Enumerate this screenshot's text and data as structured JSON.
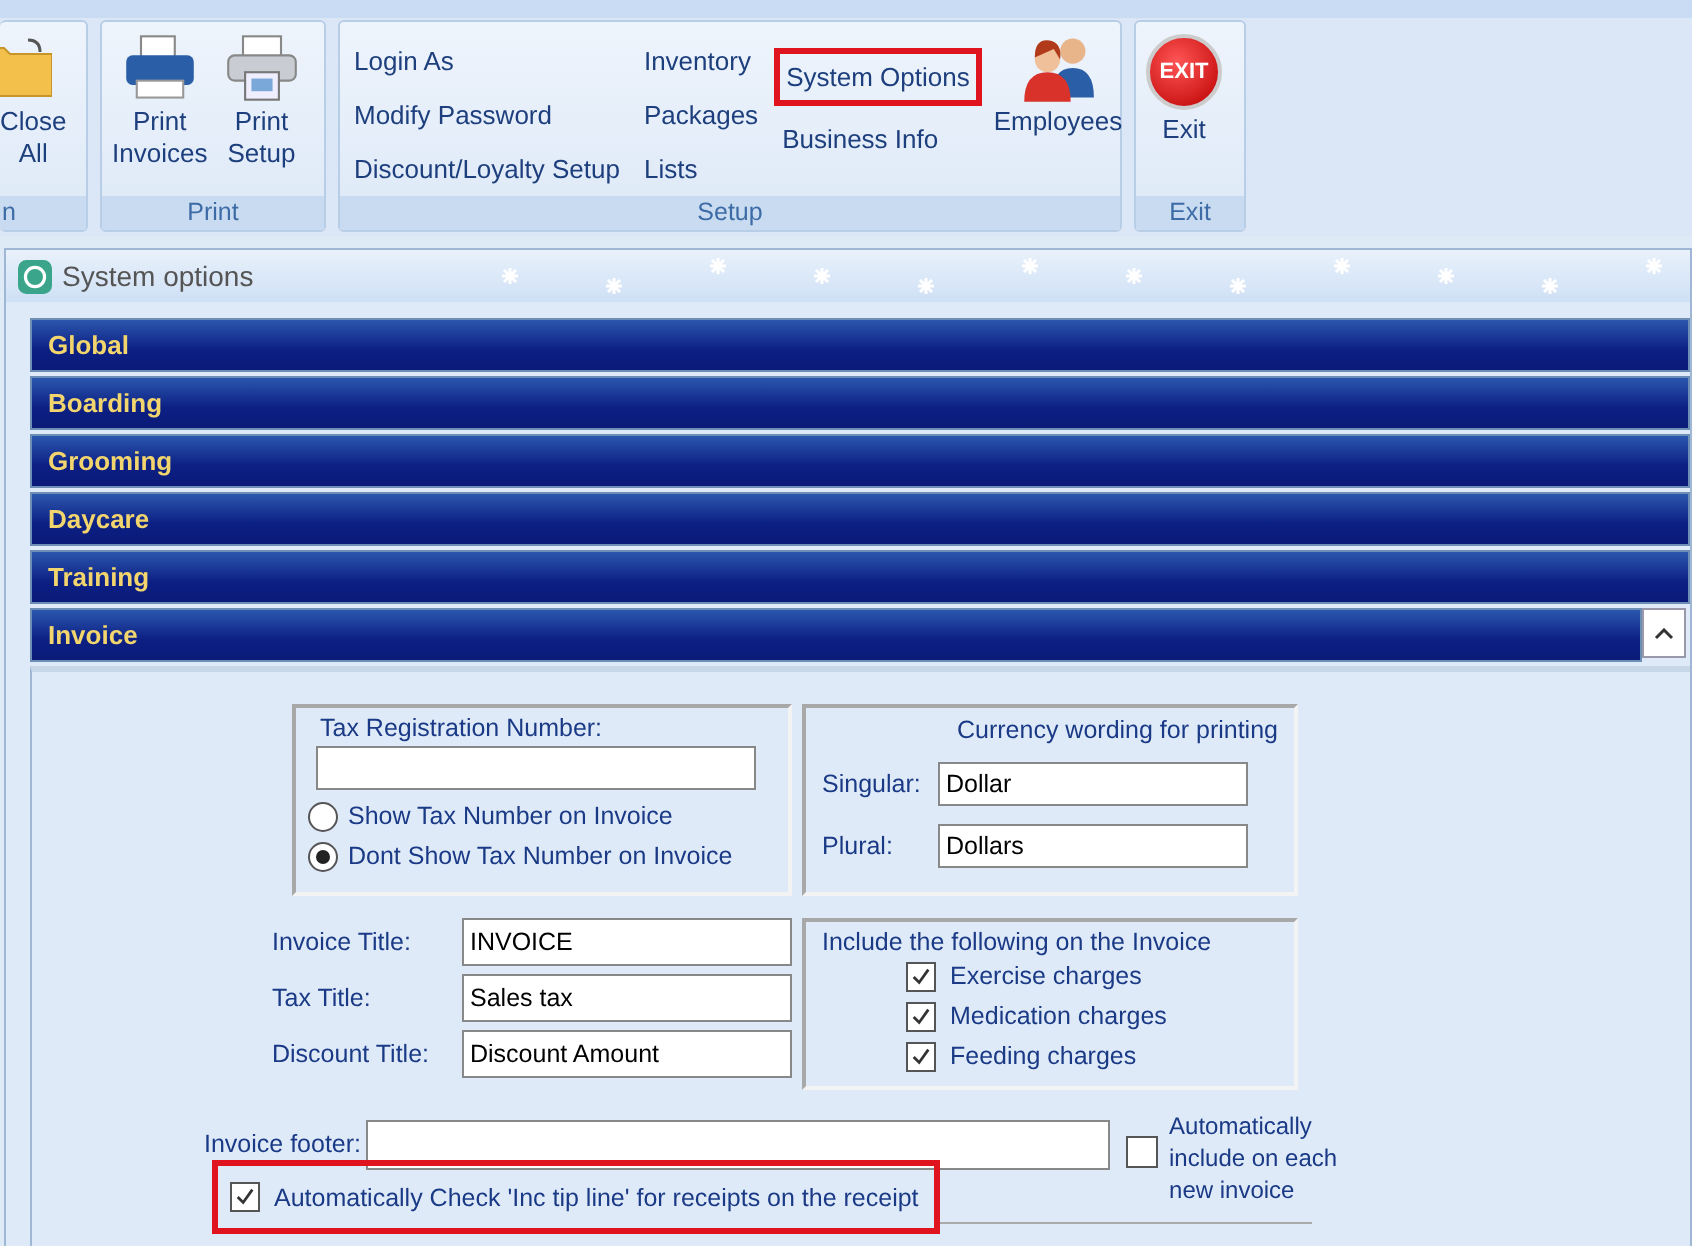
{
  "ribbon": {
    "groups": [
      {
        "label": "n",
        "buttons": [
          {
            "lines": [
              "Close",
              "All"
            ]
          }
        ]
      },
      {
        "label": "Print",
        "buttons": [
          {
            "lines": [
              "Print",
              "Invoices"
            ]
          },
          {
            "lines": [
              "Print",
              "Setup"
            ]
          }
        ]
      },
      {
        "label": "Setup",
        "link_columns": [
          [
            {
              "label": "Login As",
              "highlighted": false
            },
            {
              "label": "Modify Password",
              "highlighted": false
            },
            {
              "label": "Discount/Loyalty Setup",
              "highlighted": false
            }
          ],
          [
            {
              "label": "Inventory",
              "highlighted": false
            },
            {
              "label": "Packages",
              "highlighted": false
            },
            {
              "label": "Lists",
              "highlighted": false
            }
          ],
          [
            {
              "label": "System Options",
              "highlighted": true
            },
            {
              "label": "Business Info",
              "highlighted": false
            }
          ]
        ],
        "buttons": [
          {
            "lines": [
              "Employees"
            ]
          }
        ]
      },
      {
        "label": "Exit",
        "buttons": [
          {
            "lines": [
              "Exit"
            ],
            "badge": "EXIT"
          }
        ]
      }
    ]
  },
  "window": {
    "title": "System options"
  },
  "sections": [
    {
      "label": "Global",
      "expanded": false
    },
    {
      "label": "Boarding",
      "expanded": false
    },
    {
      "label": "Grooming",
      "expanded": false
    },
    {
      "label": "Daycare",
      "expanded": false
    },
    {
      "label": "Training",
      "expanded": false
    },
    {
      "label": "Invoice",
      "expanded": true
    }
  ],
  "invoice": {
    "tax": {
      "label": "Tax Registration Number:",
      "options": [
        {
          "label": "Show Tax Number on Invoice",
          "selected": false
        },
        {
          "label": "Dont Show Tax Number on Invoice",
          "selected": true
        }
      ]
    },
    "currency": {
      "title": "Currency wording for printing",
      "fields": [
        {
          "label": "Singular:",
          "value": "Dollar"
        },
        {
          "label": "Plural:",
          "value": "Dollars"
        }
      ]
    },
    "fields": [
      {
        "label": "Invoice Title:",
        "value": "INVOICE"
      },
      {
        "label": "Tax Title:",
        "value": "Sales tax"
      },
      {
        "label": "Discount Title:",
        "value": "Discount Amount"
      }
    ],
    "include": {
      "title": "Include the following on the Invoice",
      "items": [
        {
          "label": "Exercise charges",
          "checked": true
        },
        {
          "label": "Medication charges",
          "checked": true
        },
        {
          "label": "Feeding charges",
          "checked": true
        }
      ]
    },
    "footer": {
      "label": "Invoice footer:"
    },
    "auto_include": {
      "label": "Automatically include on each new invoice",
      "checked": false
    },
    "tip": {
      "label": "Automatically Check 'Inc tip line' for receipts on the receipt",
      "checked": true,
      "highlighted": true
    }
  }
}
